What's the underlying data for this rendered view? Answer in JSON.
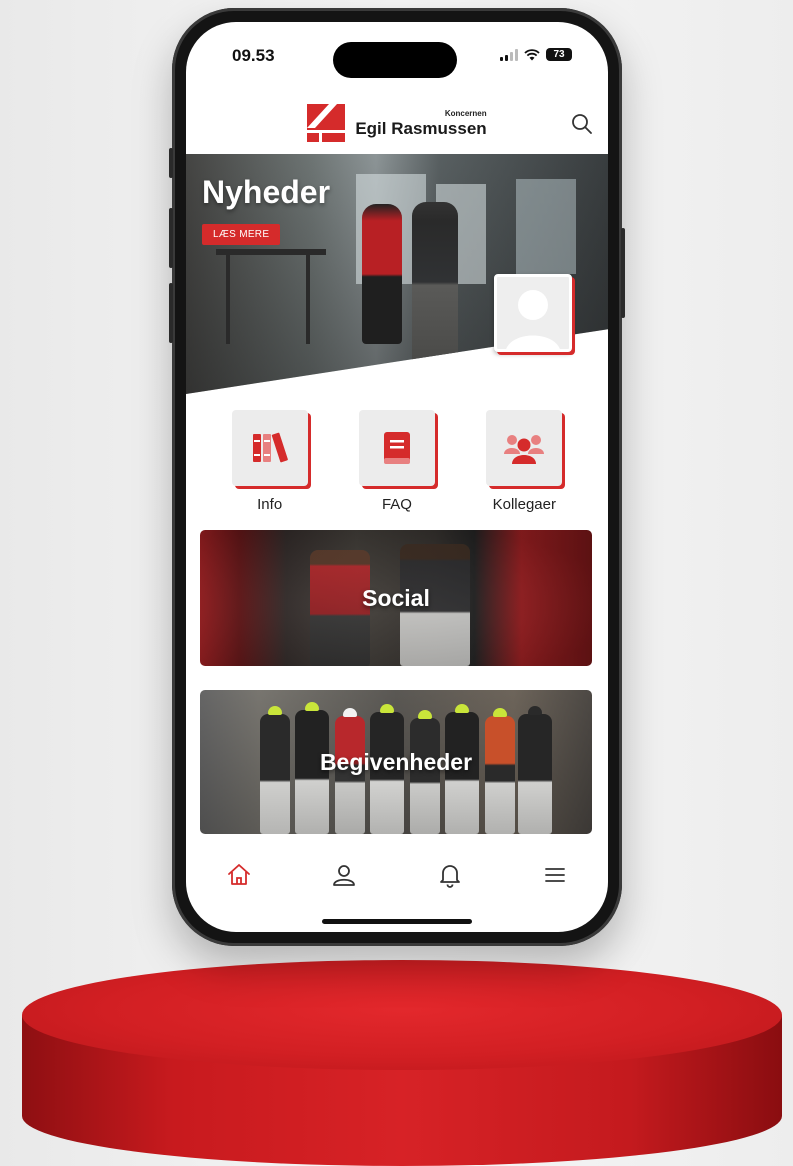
{
  "status_bar": {
    "time": "09.53",
    "battery": "73"
  },
  "header": {
    "brand_small": "Koncernen",
    "brand_name": "Egil Rasmussen",
    "accent_color": "#d52b2b"
  },
  "hero": {
    "title": "Nyheder",
    "button_label": "LÆS MERE"
  },
  "tiles": [
    {
      "label": "Info",
      "icon": "books-icon"
    },
    {
      "label": "FAQ",
      "icon": "book-icon"
    },
    {
      "label": "Kollegaer",
      "icon": "people-icon"
    }
  ],
  "cards": [
    {
      "label": "Social"
    },
    {
      "label": "Begivenheder"
    }
  ],
  "bottom_nav": [
    {
      "icon": "home-icon",
      "active": true
    },
    {
      "icon": "user-icon",
      "active": false
    },
    {
      "icon": "bell-icon",
      "active": false
    },
    {
      "icon": "menu-icon",
      "active": false
    }
  ]
}
